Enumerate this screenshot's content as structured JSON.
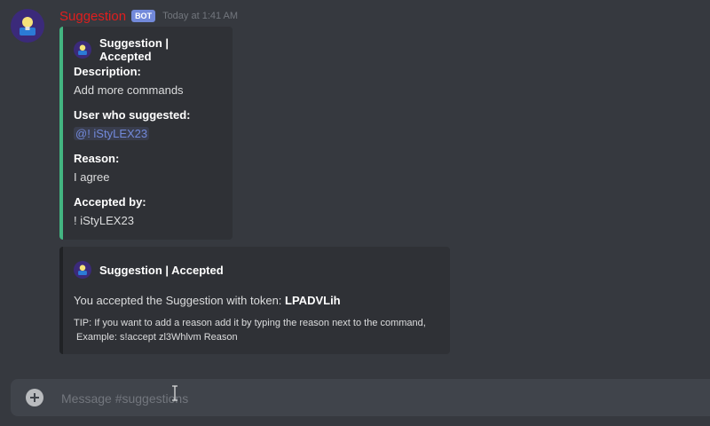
{
  "message": {
    "author": "Suggestion",
    "bot_tag": "BOT",
    "timestamp": "Today at 1:41 AM"
  },
  "embed1": {
    "author": "Suggestion | Accepted",
    "accent_color": "#43b581",
    "fields": [
      {
        "name": "Description:",
        "value": "Add more commands"
      },
      {
        "name": "User who suggested:",
        "value": "@! iStyLEX23"
      },
      {
        "name": "Reason:",
        "value": "I agree"
      },
      {
        "name": "Accepted by:",
        "value": "! iStyLEX23"
      }
    ]
  },
  "embed2": {
    "author": "Suggestion | Accepted",
    "description_prefix": "You accepted the Suggestion with token: ",
    "token": "LPADVLih",
    "tip_line1": "TIP: If you want to add a reason add it by typing the reason next to the command,",
    "tip_line2": " Example: s!accept zl3Whlvm Reason"
  },
  "composer": {
    "placeholder": "Message #suggestions"
  },
  "icons": {
    "avatar": "lightbulb-icon",
    "add": "plus-circle-icon",
    "cursor": "text-cursor-icon"
  }
}
